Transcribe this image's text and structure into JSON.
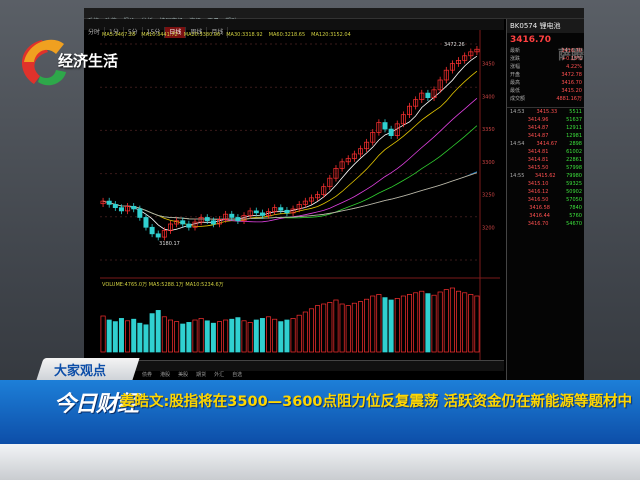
{
  "channel": {
    "name": "经济生活",
    "watermark": "萨腾"
  },
  "menu": [
    "系统",
    "功能",
    "报价",
    "分析",
    "扩展市场",
    "资讯",
    "工具",
    "帮助"
  ],
  "tabs": [
    {
      "label": "分时",
      "active": false
    },
    {
      "label": "1分",
      "active": false
    },
    {
      "label": "5分",
      "active": false
    },
    {
      "label": "15分",
      "active": false
    },
    {
      "label": "日线",
      "active": true
    },
    {
      "label": "周线",
      "active": false
    },
    {
      "label": "月线",
      "active": false
    }
  ],
  "ma_legend": [
    "MA5:3467.28",
    "MA10:3441.72",
    "MA20:3380.06",
    "MA30:3318.92",
    "MA60:3218.65",
    "MA120:3152.04"
  ],
  "volume_legend": "VOLUME:4765.0万 MA5:5288.1万 MA10:5234.6万",
  "annotations": {
    "high": "3472.26",
    "low": "3180.17"
  },
  "y_axis": [
    "3450",
    "3400",
    "3350",
    "3300",
    "3250",
    "3200"
  ],
  "bottom_tabs": [
    "沪深",
    "指数",
    "基金",
    "债券",
    "港股",
    "美股",
    "期货",
    "外汇",
    "自选"
  ],
  "right_panel": {
    "code": "BK0574",
    "name": "锂电池",
    "price": "3416.70",
    "stats": [
      {
        "k": "最新",
        "v": "3416.70"
      },
      {
        "k": "涨跌",
        "v": "+0.15%"
      },
      {
        "k": "涨幅",
        "v": "4.22%"
      },
      {
        "k": "开盘",
        "v": "3472.78"
      },
      {
        "k": "最高",
        "v": "3416.70"
      },
      {
        "k": "最低",
        "v": "3415.20"
      },
      {
        "k": "成交额",
        "v": "4881.16万"
      }
    ],
    "ticks": [
      {
        "t": "14:53",
        "p": "3415.33",
        "v": "5511"
      },
      {
        "t": "",
        "p": "3414.96",
        "v": "51637"
      },
      {
        "t": "",
        "p": "3414.87",
        "v": "12911"
      },
      {
        "t": "",
        "p": "3414.87",
        "v": "12981"
      },
      {
        "t": "14:54",
        "p": "3414.67",
        "v": "2898"
      },
      {
        "t": "",
        "p": "3414.81",
        "v": "61002"
      },
      {
        "t": "",
        "p": "3414.81",
        "v": "22861"
      },
      {
        "t": "",
        "p": "3415.50",
        "v": "57998"
      },
      {
        "t": "14:55",
        "p": "3415.62",
        "v": "79980"
      },
      {
        "t": "",
        "p": "3415.10",
        "v": "59325"
      },
      {
        "t": "",
        "p": "3416.12",
        "v": "50902"
      },
      {
        "t": "",
        "p": "3416.50",
        "v": "57050"
      },
      {
        "t": "",
        "p": "3416.58",
        "v": "7840"
      },
      {
        "t": "",
        "p": "3416.44",
        "v": "5760"
      },
      {
        "t": "",
        "p": "3416.70",
        "v": "54670"
      }
    ]
  },
  "lower_third": {
    "tag": "大家观点",
    "show": "今日财经",
    "headline": "姜皓文:股指将在3500—3600点阻力位反复震荡 活跃资金仍在新能源等题材中"
  },
  "chart_data": {
    "type": "candlestick",
    "ylim": [
      3150,
      3480
    ],
    "closes": [
      3240,
      3235,
      3230,
      3225,
      3232,
      3228,
      3215,
      3200,
      3190,
      3185,
      3195,
      3205,
      3210,
      3205,
      3200,
      3208,
      3215,
      3210,
      3205,
      3212,
      3220,
      3215,
      3210,
      3218,
      3225,
      3222,
      3218,
      3224,
      3230,
      3226,
      3222,
      3228,
      3235,
      3240,
      3245,
      3250,
      3262,
      3275,
      3290,
      3300,
      3305,
      3312,
      3320,
      3330,
      3345,
      3360,
      3350,
      3340,
      3358,
      3372,
      3385,
      3395,
      3405,
      3398,
      3410,
      3425,
      3440,
      3450,
      3455,
      3462,
      3468,
      3472
    ],
    "volumes": [
      45,
      40,
      38,
      42,
      39,
      41,
      36,
      34,
      48,
      52,
      44,
      40,
      38,
      35,
      37,
      40,
      42,
      39,
      36,
      38,
      40,
      41,
      43,
      39,
      37,
      40,
      42,
      44,
      41,
      38,
      40,
      42,
      46,
      50,
      54,
      58,
      60,
      62,
      65,
      60,
      58,
      61,
      63,
      66,
      70,
      72,
      68,
      65,
      67,
      70,
      72,
      74,
      76,
      73,
      71,
      75,
      78,
      80,
      76,
      74,
      72,
      70
    ]
  }
}
